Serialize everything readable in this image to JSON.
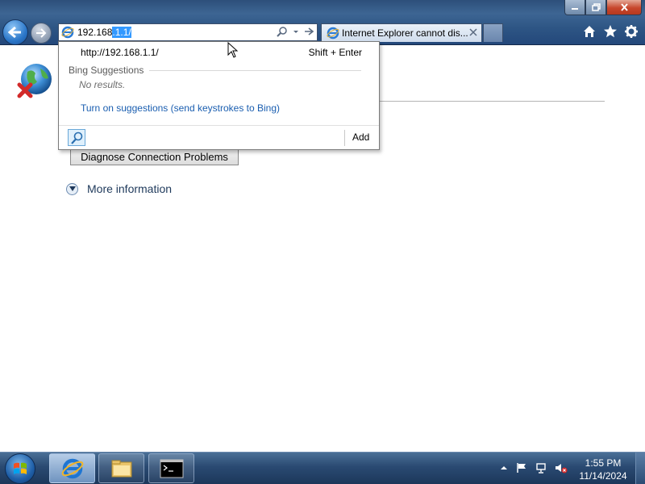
{
  "browser": {
    "address": {
      "prefix": "192.168",
      "selected": ".1.1/"
    },
    "tab": {
      "title": "Internet Explorer cannot dis..."
    }
  },
  "icons": {
    "back": "back-arrow-icon",
    "forward": "forward-arrow-icon",
    "address_site": "ie-icon",
    "address_search": "search-icon",
    "address_dropdown": "chevron-down-icon",
    "address_go": "go-arrow-icon",
    "tab_close": "close-icon",
    "home": "home-icon",
    "favorites": "star-icon",
    "tools": "gear-icon",
    "page_error": "globe-error-icon"
  },
  "page": {
    "diagnose_button": "Diagnose Connection Problems",
    "more_info": "More information"
  },
  "dropdown": {
    "url_suggestion": "http://192.168.1.1/",
    "shortcut": "Shift + Enter",
    "heading": "Bing Suggestions",
    "no_results": "No results.",
    "turn_on_link": "Turn on suggestions (send keystrokes to Bing)",
    "add_label": "Add"
  },
  "taskbar": {
    "clock_time": "1:55 PM",
    "clock_date": "11/14/2024"
  },
  "colors": {
    "link": "#1a5eb0",
    "selection": "#3399ff",
    "titlebar": "#2e5685"
  }
}
